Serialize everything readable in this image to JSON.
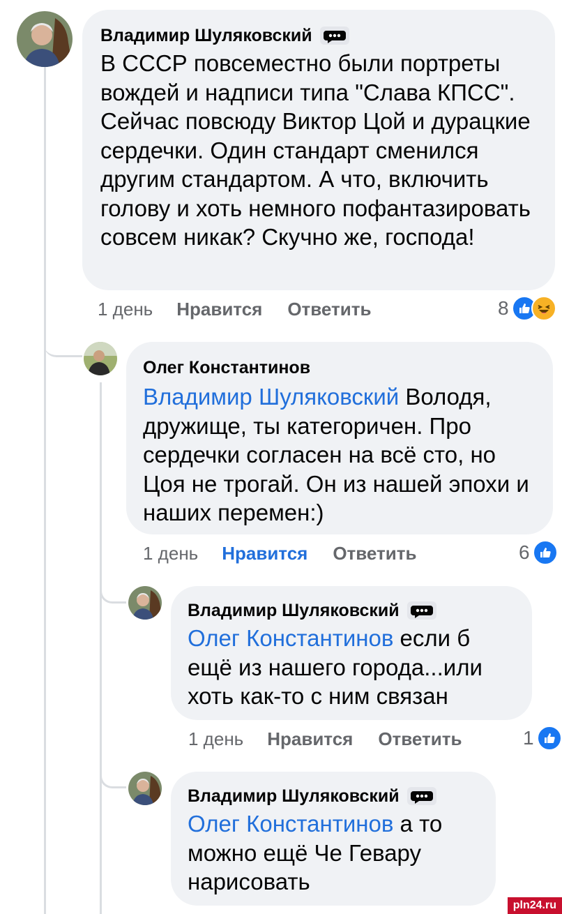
{
  "comments": [
    {
      "author": "Владимир Шуляковский",
      "text": "В СССР повсеместно были портреты вождей и надписи типа \"Слава КПСС\". Сейчас повсюду Виктор Цой и дурацкие сердечки. Один стандарт сменился другим стандартом. А что, включить голову и хоть немного пофантазировать совсем никак? Скучно же, господа!",
      "time": "1 день",
      "like_label": "Нравится",
      "reply_label": "Ответить",
      "reaction_count": "8",
      "reactions": [
        "like",
        "haha"
      ]
    },
    {
      "author": "Олег Константинов",
      "mention": "Владимир Шуляковский",
      "text": " Володя, дружище, ты категоричен. Про сердечки согласен на всё сто, но Цоя не трогай. Он из нашей эпохи и наших перемен:)",
      "time": "1 день",
      "like_label": "Нравится",
      "like_active": true,
      "reply_label": "Ответить",
      "reaction_count": "6",
      "reactions": [
        "like"
      ]
    },
    {
      "author": "Владимир Шуляковский",
      "mention": "Олег Константинов",
      "text": " если б ещё из нашего города...или хоть как-то с ним связан",
      "time": "1 день",
      "like_label": "Нравится",
      "reply_label": "Ответить",
      "reaction_count": "1",
      "reactions": [
        "like"
      ]
    },
    {
      "author": "Владимир Шуляковский",
      "mention": "Олег Константинов",
      "text": " а то можно ещё Че Гевару нарисовать"
    }
  ],
  "watermark": "pln24.ru",
  "colors": {
    "bubble": "#f0f2f5",
    "link": "#216fdb",
    "meta": "#65676b",
    "like": "#1877f2",
    "haha": "#f7b125"
  },
  "icons": {
    "author_badge": "top-fan-badge-icon",
    "like": "like-reaction-icon",
    "haha": "haha-reaction-icon"
  }
}
